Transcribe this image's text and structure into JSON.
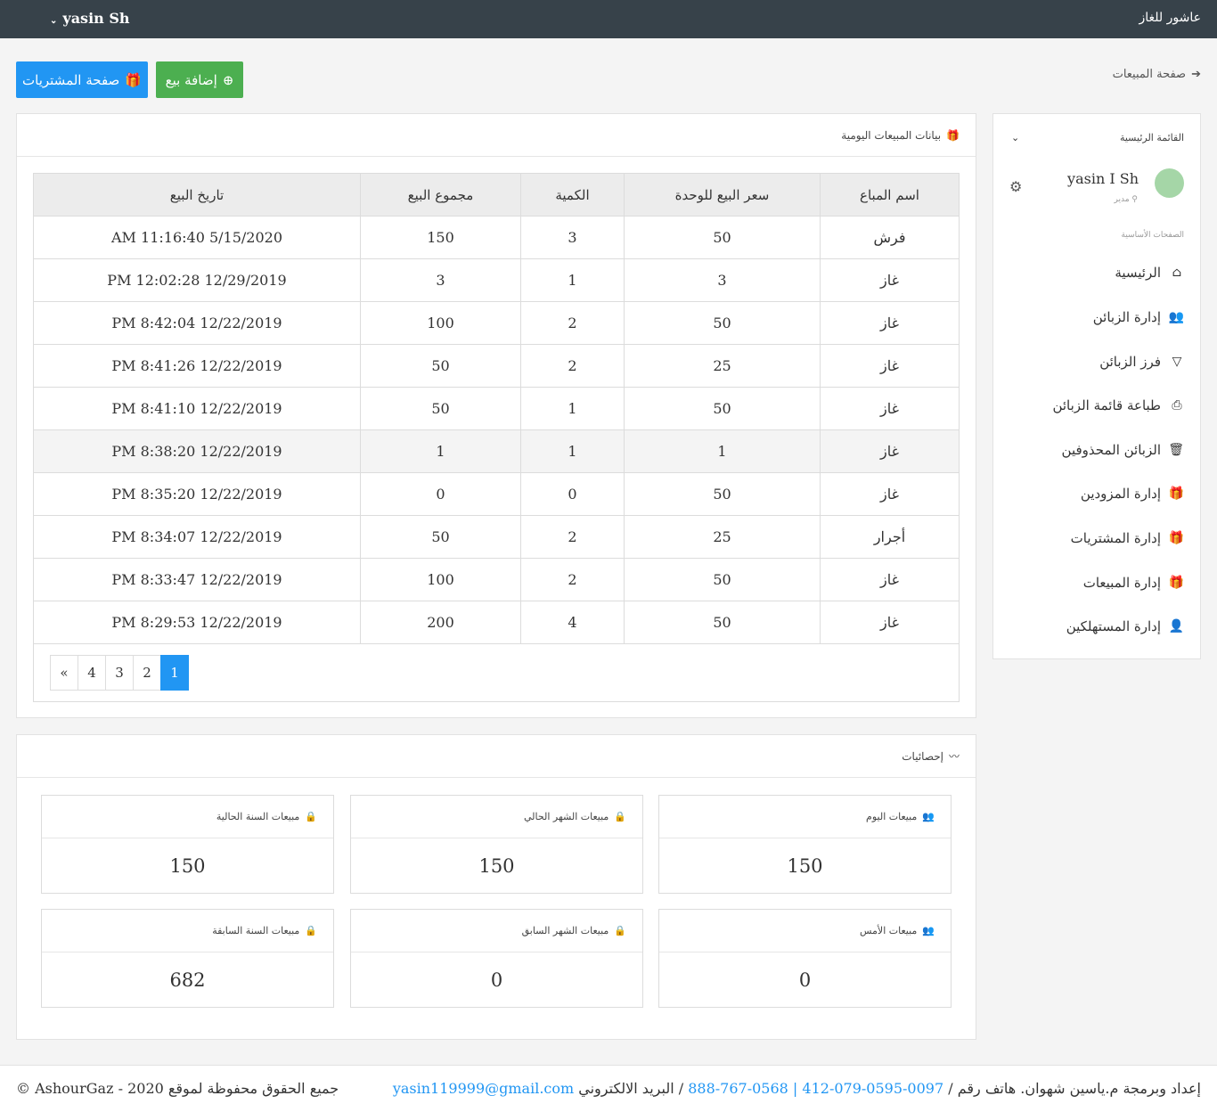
{
  "topbar": {
    "brand": "عاشور للغاز",
    "user": "yasin Sh"
  },
  "toolbar": {
    "purchases_label": "صفحة المشتريات",
    "add_sale_label": "إضافة بيع",
    "page_link": "صفحة المبيعات"
  },
  "sales": {
    "title": "بيانات المبيعات اليومية",
    "headers": [
      "اسم المباع",
      "سعر البيع للوحدة",
      "الكمية",
      "مجموع البيع",
      "تاريخ البيع"
    ],
    "rows": [
      [
        "فرش",
        "50",
        "3",
        "150",
        "AM 11:16:40 5/15/2020"
      ],
      [
        "غاز",
        "3",
        "1",
        "3",
        "PM 12:02:28 12/29/2019"
      ],
      [
        "غاز",
        "50",
        "2",
        "100",
        "PM 8:42:04 12/22/2019"
      ],
      [
        "غاز",
        "25",
        "2",
        "50",
        "PM 8:41:26 12/22/2019"
      ],
      [
        "غاز",
        "50",
        "1",
        "50",
        "PM 8:41:10 12/22/2019"
      ],
      [
        "غاز",
        "1",
        "1",
        "1",
        "PM 8:38:20 12/22/2019"
      ],
      [
        "غاز",
        "50",
        "0",
        "0",
        "PM 8:35:20 12/22/2019"
      ],
      [
        "أجرار",
        "25",
        "2",
        "50",
        "PM 8:34:07 12/22/2019"
      ],
      [
        "غاز",
        "50",
        "2",
        "100",
        "PM 8:33:47 12/22/2019"
      ],
      [
        "غاز",
        "50",
        "4",
        "200",
        "PM 8:29:53 12/22/2019"
      ]
    ],
    "pager": [
      "1",
      "2",
      "3",
      "4",
      "«"
    ]
  },
  "stats": {
    "title": "إحصائيات",
    "cards": [
      {
        "label": "مبيعات اليوم",
        "value": "150"
      },
      {
        "label": "مبيعات الشهر الحالي",
        "value": "150"
      },
      {
        "label": "مبيعات السنة الحالية",
        "value": "150"
      },
      {
        "label": "مبيعات الأمس",
        "value": "0"
      },
      {
        "label": "مبيعات الشهر السابق",
        "value": "0"
      },
      {
        "label": "مبيعات السنة السابقة",
        "value": "682"
      }
    ]
  },
  "sidebar": {
    "title": "القائمة الرئيسية",
    "user": "yasin I Sh",
    "role": "مدير",
    "section": "الصفحات الأساسية",
    "items": [
      {
        "label": "الرئيسية",
        "icon": "home-icon"
      },
      {
        "label": "إدارة الزبائن",
        "icon": "users-icon"
      },
      {
        "label": "فرز الزبائن",
        "icon": "filter-icon"
      },
      {
        "label": "طباعة قائمة الزبائن",
        "icon": "print-icon"
      },
      {
        "label": "الزبائن المحذوفين",
        "icon": "trash-icon"
      },
      {
        "label": "إدارة المزودين",
        "icon": "gift-icon"
      },
      {
        "label": "إدارة المشتريات",
        "icon": "gift-icon"
      },
      {
        "label": "إدارة المبيعات",
        "icon": "gift-icon"
      },
      {
        "label": "إدارة المستهلكين",
        "icon": "user-icon"
      }
    ]
  },
  "footer": {
    "credit": "إعداد وبرمجة م.ياسين شهوان. هاتف رقم /",
    "phones": "0097-0595-079-412 | 0568-767-888",
    "email_label": "/ البريد الالكتروني",
    "email": "yasin119999@gmail.com",
    "copyright": "جميع الحقوق محفوظة لموقع 2020 - AshourGaz ©"
  }
}
